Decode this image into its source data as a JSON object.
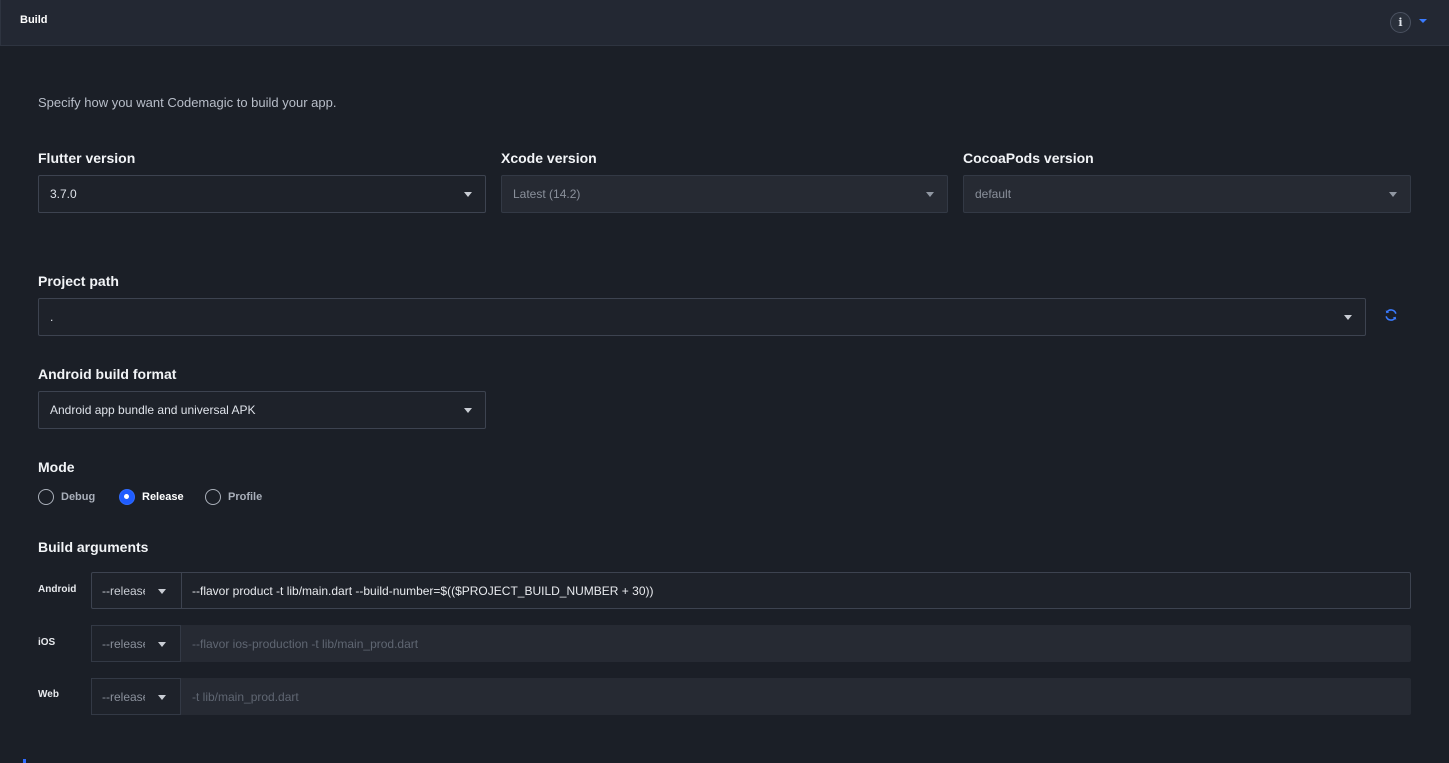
{
  "header": {
    "title": "Build"
  },
  "intro": "Specify how you want Codemagic to build your app.",
  "versions": {
    "flutter": {
      "label": "Flutter version",
      "value": "3.7.0"
    },
    "xcode": {
      "label": "Xcode version",
      "value": "Latest (14.2)"
    },
    "cocoapods": {
      "label": "CocoaPods version",
      "value": "default"
    }
  },
  "project_path": {
    "label": "Project path",
    "value": "."
  },
  "android_build_format": {
    "label": "Android build format",
    "value": "Android app bundle and universal APK"
  },
  "mode": {
    "label": "Mode",
    "options": [
      "Debug",
      "Release",
      "Profile"
    ],
    "selected": "Release"
  },
  "build_arguments": {
    "label": "Build arguments",
    "rows": [
      {
        "platform": "Android",
        "mode": "--release",
        "args": "--flavor product -t lib/main.dart --build-number=$(($PROJECT_BUILD_NUMBER + 30))"
      },
      {
        "platform": "iOS",
        "mode": "--release",
        "args": "--flavor ios-production -t lib/main_prod.dart"
      },
      {
        "platform": "Web",
        "mode": "--release",
        "args": "-t lib/main_prod.dart"
      }
    ]
  },
  "icons": {
    "info": "info-icon",
    "collapse": "chevron-down-icon",
    "refresh": "refresh-icon"
  },
  "colors": {
    "accent": "#1f5cff",
    "background": "#1b1f27",
    "header": "#232833"
  }
}
